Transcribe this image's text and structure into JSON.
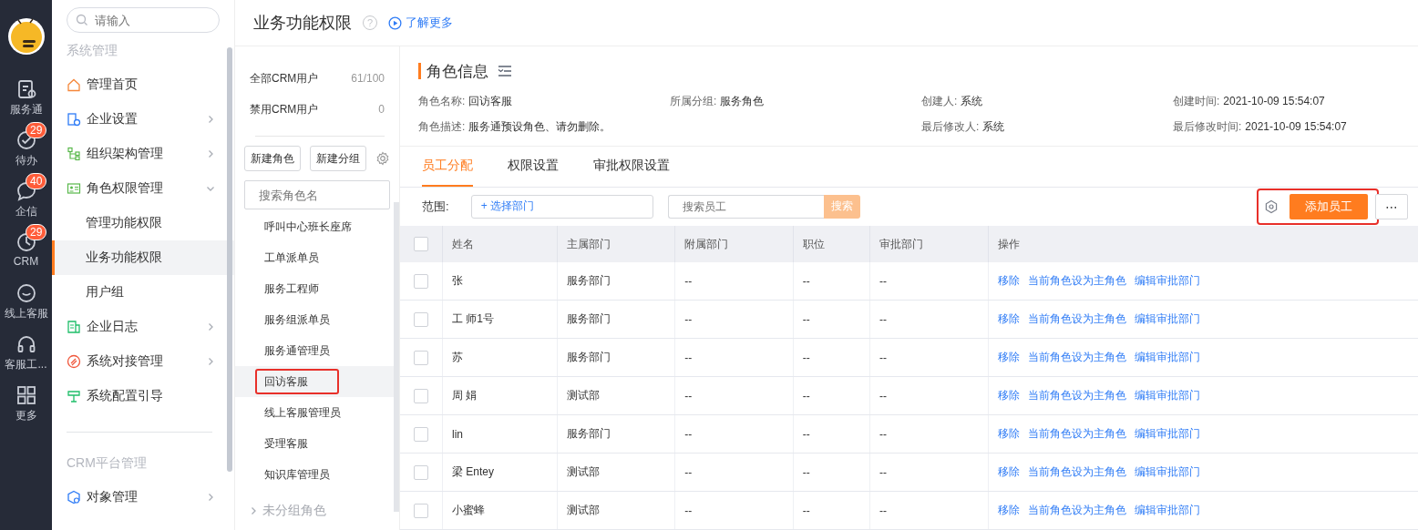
{
  "rail": {
    "items": [
      {
        "label": "服务通"
      },
      {
        "label": "待办",
        "badge": "29"
      },
      {
        "label": "企信",
        "badge": "40"
      },
      {
        "label": "CRM",
        "badge": "29"
      },
      {
        "label": "线上客服"
      },
      {
        "label": "客服工..."
      },
      {
        "label": "更多"
      }
    ]
  },
  "nav": {
    "search": {
      "placeholder": "请输入"
    },
    "sections": [
      {
        "heading": "系统管理",
        "items": [
          {
            "label": "管理首页"
          },
          {
            "label": "企业设置",
            "expanded": false
          },
          {
            "label": "组织架构管理",
            "expanded": false
          },
          {
            "label": "角色权限管理",
            "expanded": true,
            "children": [
              {
                "label": "管理功能权限",
                "selected": false
              },
              {
                "label": "业务功能权限",
                "selected": true
              },
              {
                "label": "用户组",
                "selected": false
              }
            ]
          },
          {
            "label": "企业日志",
            "expanded": false
          },
          {
            "label": "系统对接管理",
            "expanded": false
          },
          {
            "label": "系统配置引导"
          }
        ]
      },
      {
        "heading": "CRM平台管理",
        "items": [
          {
            "label": "对象管理",
            "expanded": false
          }
        ]
      }
    ]
  },
  "header": {
    "title": "业务功能权限",
    "help": "?",
    "link": "了解更多"
  },
  "roles": {
    "summary": [
      {
        "label": "全部CRM用户",
        "count": "61/100"
      },
      {
        "label": "禁用CRM用户",
        "count": "0"
      }
    ],
    "buttons": [
      "新建角色",
      "新建分组"
    ],
    "search": {
      "placeholder": "搜索角色名"
    },
    "items": [
      {
        "label": "呼叫中心班长座席",
        "selected": false
      },
      {
        "label": "工单派单员",
        "selected": false
      },
      {
        "label": "服务工程师",
        "selected": false
      },
      {
        "label": "服务组派单员",
        "selected": false
      },
      {
        "label": "服务通管理员",
        "selected": false
      },
      {
        "label": "回访客服",
        "selected": true,
        "highlighted": true
      },
      {
        "label": "线上客服管理员",
        "selected": false
      },
      {
        "label": "受理客服",
        "selected": false
      },
      {
        "label": "知识库管理员",
        "selected": false
      }
    ],
    "group": {
      "label": "未分组角色",
      "expanded": false
    }
  },
  "info": {
    "title": "角色信息",
    "rows": [
      [
        {
          "label": "角色名称:",
          "value": "回访客服"
        },
        {
          "label": "所属分组:",
          "value": "服务角色"
        },
        {
          "label": "创建人:",
          "value": "系统"
        },
        {
          "label": "创建时间:",
          "value": "2021-10-09 15:54:07"
        }
      ],
      [
        {
          "label": "角色描述:",
          "value": "服务通预设角色、请勿删除。"
        },
        null,
        {
          "label": "最后修改人:",
          "value": "系统"
        },
        {
          "label": "最后修改时间:",
          "value": "2021-10-09 15:54:07"
        }
      ]
    ]
  },
  "tabs": [
    {
      "label": "员工分配",
      "selected": true
    },
    {
      "label": "权限设置",
      "selected": false
    },
    {
      "label": "审批权限设置",
      "selected": false
    }
  ],
  "filter": {
    "scope_label": "范围:",
    "dept_button": "+ 选择部门",
    "search": {
      "placeholder": "搜索员工"
    },
    "search_button": "搜索",
    "add_button": "添加员工",
    "highlighted": true,
    "more": "⋯"
  },
  "table": {
    "select_all_checked": false,
    "columns": [
      "姓名",
      "主属部门",
      "附属部门",
      "职位",
      "审批部门",
      "操作"
    ],
    "rows": [
      {
        "checked": false,
        "cells": [
          "张",
          "服务部门",
          "--",
          "--",
          "--"
        ],
        "actions": [
          "移除",
          "当前角色设为主角色",
          "编辑审批部门"
        ]
      },
      {
        "checked": false,
        "cells": [
          "工  师1号",
          "服务部门",
          "--",
          "--",
          "--"
        ],
        "actions": [
          "移除",
          "当前角色设为主角色",
          "编辑审批部门"
        ]
      },
      {
        "checked": false,
        "cells": [
          "苏",
          "服务部门",
          "--",
          "--",
          "--"
        ],
        "actions": [
          "移除",
          "当前角色设为主角色",
          "编辑审批部门"
        ]
      },
      {
        "checked": false,
        "cells": [
          "周  娟",
          "测试部",
          "--",
          "--",
          "--"
        ],
        "actions": [
          "移除",
          "当前角色设为主角色",
          "编辑审批部门"
        ]
      },
      {
        "checked": false,
        "cells": [
          "lin",
          "服务部门",
          "--",
          "--",
          "--"
        ],
        "actions": [
          "移除",
          "当前角色设为主角色",
          "编辑审批部门"
        ]
      },
      {
        "checked": false,
        "cells": [
          "梁  Entey",
          "测试部",
          "--",
          "--",
          "--"
        ],
        "actions": [
          "移除",
          "当前角色设为主角色",
          "编辑审批部门"
        ]
      },
      {
        "checked": false,
        "cells": [
          "小蜜蜂",
          "测试部",
          "--",
          "--",
          "--"
        ],
        "actions": [
          "移除",
          "当前角色设为主角色",
          "编辑审批部门"
        ]
      }
    ]
  }
}
